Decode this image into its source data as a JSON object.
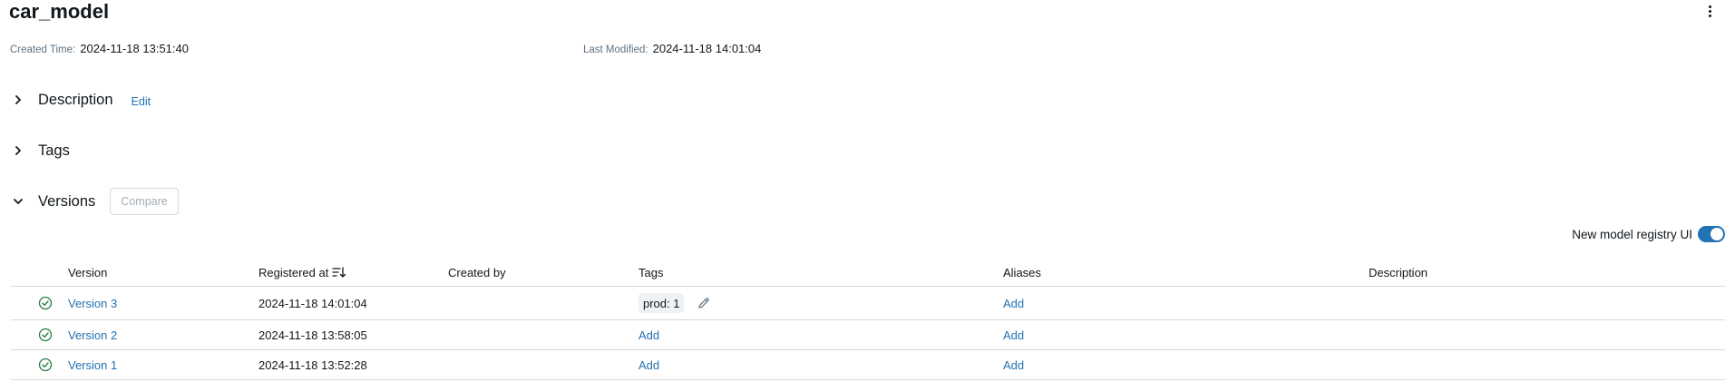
{
  "model": {
    "name": "car_model",
    "more_icon": "kebab-vertical-icon"
  },
  "meta": {
    "created_label": "Created Time:",
    "created_value": "2024-11-18 13:51:40",
    "modified_label": "Last Modified:",
    "modified_value": "2024-11-18 14:01:04"
  },
  "sections": {
    "description": {
      "title": "Description",
      "edit_label": "Edit",
      "expanded": false
    },
    "tags": {
      "title": "Tags",
      "expanded": false
    },
    "versions": {
      "title": "Versions",
      "compare_label": "Compare",
      "expanded": true
    }
  },
  "toggle": {
    "label": "New model registry UI",
    "on": true
  },
  "table": {
    "columns": [
      "Version",
      "Registered at",
      "Created by",
      "Tags",
      "Aliases",
      "Description"
    ],
    "rows": [
      {
        "status_icon": "check-circle-icon",
        "version": "Version 3",
        "registered_at": "2024-11-18 14:01:04",
        "created_by": "",
        "tag": "prod: 1",
        "tags_add": "",
        "aliases": "Add",
        "description": ""
      },
      {
        "status_icon": "check-circle-icon",
        "version": "Version 2",
        "registered_at": "2024-11-18 13:58:05",
        "created_by": "",
        "tag": "",
        "tags_add": "Add",
        "aliases": "Add",
        "description": ""
      },
      {
        "status_icon": "check-circle-icon",
        "version": "Version 1",
        "registered_at": "2024-11-18 13:52:28",
        "created_by": "",
        "tag": "",
        "tags_add": "Add",
        "aliases": "Add",
        "description": ""
      }
    ]
  },
  "colors": {
    "link": "#2272b4",
    "success": "#277c43",
    "border": "#d1d9e1",
    "muted": "#5f7281"
  }
}
